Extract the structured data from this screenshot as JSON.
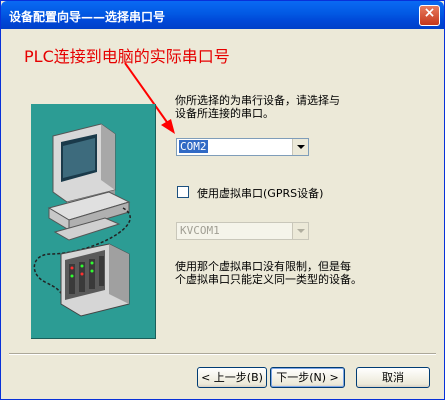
{
  "window": {
    "title": "设备配置向导——选择串口号",
    "close_glyph": "×"
  },
  "annotation": {
    "text": "PLC连接到电脑的实际串口号",
    "color": "#e60000"
  },
  "instructions": {
    "line1": "你所选择的为串行设备，请选择与",
    "line2": "设备所连接的串口。"
  },
  "port_select": {
    "value": "COM2"
  },
  "virtual_port": {
    "label": "使用虚拟串口(GPRS设备)",
    "checked": false,
    "select_value": "KVCOM1"
  },
  "note": {
    "line1": "使用那个虚拟串口没有限制，但是每",
    "line2": "个虚拟串口只能定义同一类型的设备。"
  },
  "buttons": {
    "back": "< 上一步(B)",
    "next": "下一步(N) >",
    "cancel": "取消"
  },
  "colors": {
    "titlebar": "#0259e3",
    "illustration_bg": "#2c9c94"
  }
}
